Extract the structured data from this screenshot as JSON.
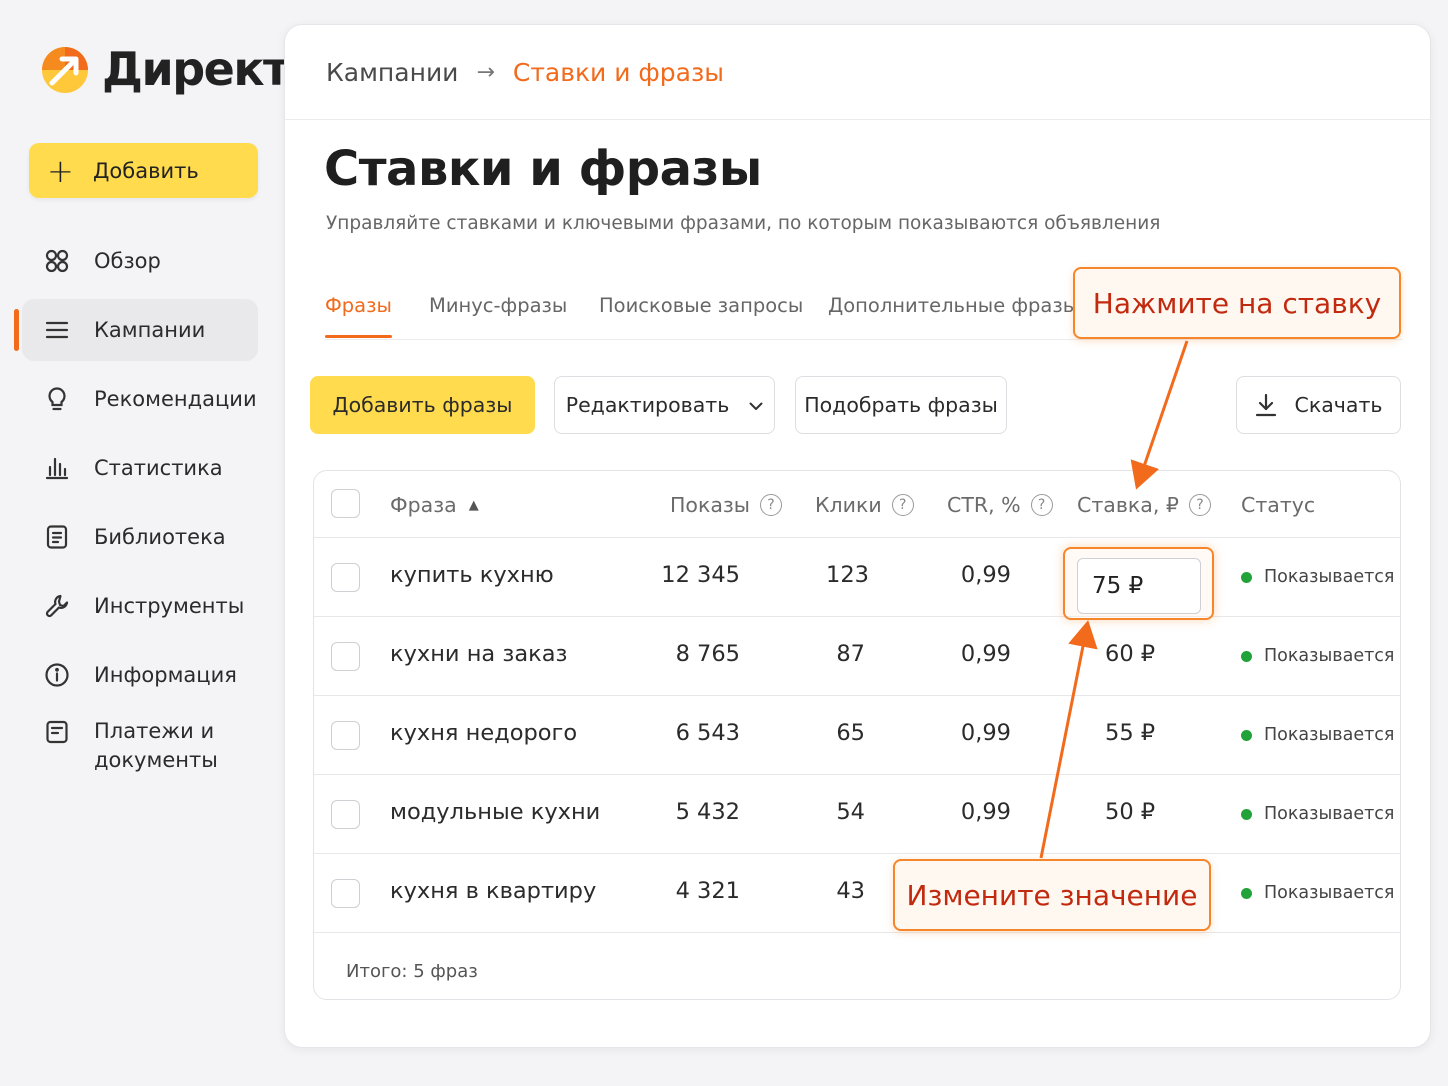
{
  "app": {
    "logo_text": "Директ",
    "add_button": "Добавить"
  },
  "sidebar": {
    "items": [
      {
        "label": "Обзор",
        "icon": "overview-icon"
      },
      {
        "label": "Кампании",
        "icon": "campaigns-list-icon",
        "active": true
      },
      {
        "label": "Рекомендации",
        "icon": "lightbulb-icon"
      },
      {
        "label": "Статистика",
        "icon": "bar-chart-icon"
      },
      {
        "label": "Библиотека",
        "icon": "library-icon"
      },
      {
        "label": "Инструменты",
        "icon": "wrench-icon"
      },
      {
        "label": "Информация",
        "icon": "info-icon"
      },
      {
        "label_line1": "Платежи и",
        "label_line2": "документы",
        "icon": "payments-icon"
      }
    ]
  },
  "breadcrumb": {
    "parent": "Кампании",
    "separator": "→",
    "current": "Ставки и фразы"
  },
  "page": {
    "title": "Ставки и фразы",
    "subtitle": "Управляйте ставками и ключевыми фразами, по которым показываются объявления"
  },
  "tabs": [
    {
      "label": "Фразы",
      "active": true
    },
    {
      "label": "Минус-фразы"
    },
    {
      "label": "Поисковые запросы"
    },
    {
      "label": "Дополнительные фразы"
    }
  ],
  "toolbar": {
    "add_phrases": "Добавить фразы",
    "edit": "Редактировать",
    "pick_phrases": "Подобрать фразы",
    "download": "Скачать"
  },
  "table": {
    "headers": {
      "phrase": "Фраза",
      "impressions": "Показы",
      "clicks": "Клики",
      "ctr": "CTR, %",
      "bid": "Ставка, ₽",
      "status": "Статус",
      "help": "?",
      "sort": "▲"
    },
    "rows": [
      {
        "phrase": "купить кухню",
        "impressions": "12 345",
        "clicks": "123",
        "ctr": "0,99",
        "bid": "75 ₽",
        "status": "Показывается"
      },
      {
        "phrase": "кухни на заказ",
        "impressions": "8 765",
        "clicks": "87",
        "ctr": "0,99",
        "bid": "60 ₽",
        "status": "Показывается"
      },
      {
        "phrase": "кухня недорого",
        "impressions": "6 543",
        "clicks": "65",
        "ctr": "0,99",
        "bid": "55 ₽",
        "status": "Показывается"
      },
      {
        "phrase": "модульные кухни",
        "impressions": "5 432",
        "clicks": "54",
        "ctr": "0,99",
        "bid": "50 ₽",
        "status": "Показывается"
      },
      {
        "phrase": "кухня в квартиру",
        "impressions": "4 321",
        "clicks": "43",
        "ctr": "",
        "bid": "",
        "status": "Показывается"
      }
    ],
    "footer_label": "Итого:",
    "footer_value": "5 фраз"
  },
  "callouts": {
    "click_bid": "Нажмите на ставку",
    "change_value": "Измените значение"
  },
  "colors": {
    "accent": "#f26a1b",
    "primary_button": "#ffdb4d",
    "status_ok": "#22a33a",
    "callout_border": "#f5862b",
    "callout_text": "#c22a10"
  }
}
